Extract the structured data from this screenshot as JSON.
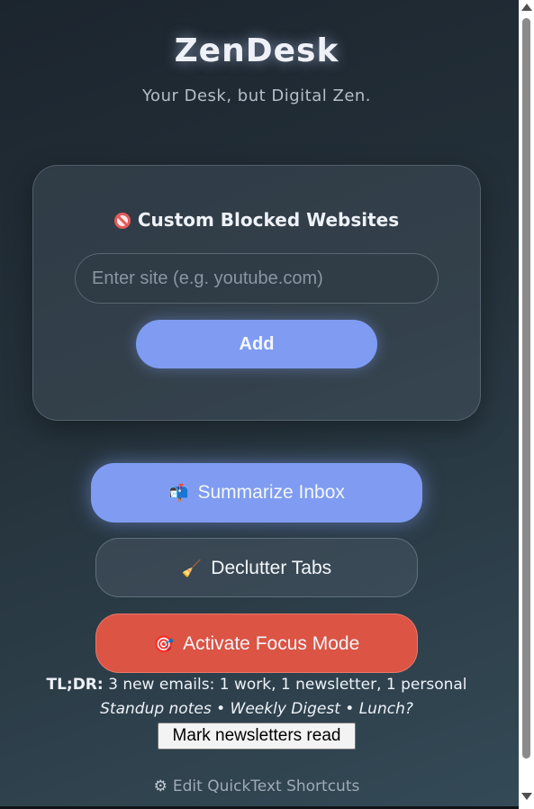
{
  "header": {
    "title": "ZenDesk",
    "tagline": "Your Desk, but Digital Zen."
  },
  "blocked_sites": {
    "heading": "Custom Blocked Websites",
    "heading_icon": "no-entry-icon",
    "input_placeholder": "Enter site (e.g. youtube.com)",
    "input_value": "",
    "add_label": "Add"
  },
  "actions": {
    "summarize_label": "Summarize Inbox",
    "summarize_icon": "📬",
    "declutter_label": "Declutter Tabs",
    "declutter_icon": "🧹",
    "focus_label": "Activate Focus Mode",
    "focus_icon": "🎯"
  },
  "summary": {
    "tldr_label": "TL;DR:",
    "tldr_text": " 3 new emails: 1 work, 1 newsletter, 1 personal",
    "items_text": "Standup notes • Weekly Digest • Lunch?",
    "mark_read_label": "Mark newsletters read"
  },
  "footer": {
    "edit_icon": "⚙",
    "edit_label": "Edit QuickText Shortcuts"
  },
  "colors": {
    "accent": "#7f9cf2",
    "danger": "#db5444"
  }
}
